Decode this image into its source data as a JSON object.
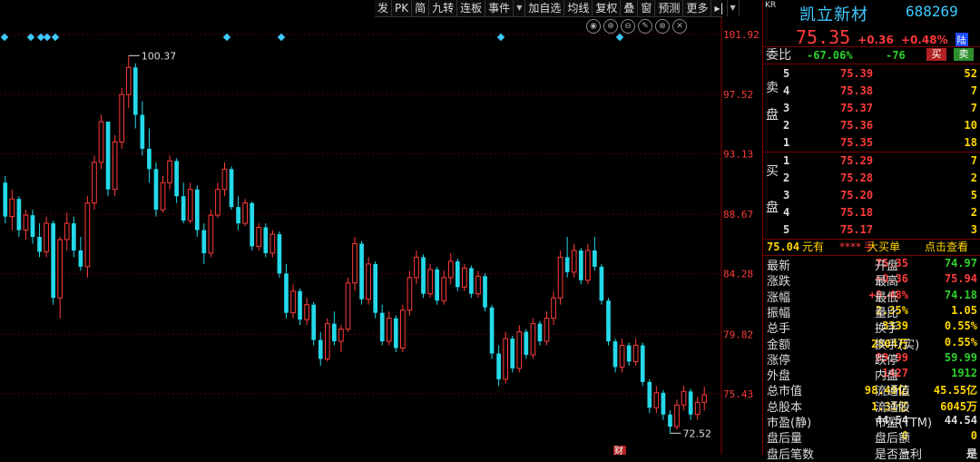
{
  "toolbar": {
    "items": [
      "发",
      "PK",
      "简",
      "九转",
      "连板",
      "事件",
      "加自选",
      "均线",
      "复权",
      "叠",
      "窗",
      "预测",
      "更多"
    ],
    "event_dropdown_arrow": "▼",
    "pin_glyph": "▸|",
    "menu_arrow": "▼"
  },
  "chart_data": {
    "type": "candlestick",
    "y_ticks": [
      "101.92",
      "97.52",
      "93.13",
      "88.67",
      "84.28",
      "79.82",
      "75.43"
    ],
    "annotations": {
      "high": "100.37",
      "low": "72.52"
    },
    "colors": {
      "up": "#ff3b3b",
      "down": "#25d9e9"
    },
    "bottom_marker": "财",
    "candles": [
      [
        91.0,
        91.5,
        88.0,
        88.5
      ],
      [
        88.5,
        90.5,
        87.5,
        89.8
      ],
      [
        89.8,
        90.0,
        87.0,
        87.5
      ],
      [
        87.5,
        89.0,
        86.8,
        88.6
      ],
      [
        88.6,
        89.0,
        86.5,
        87.0
      ],
      [
        87.0,
        88.0,
        85.5,
        85.9
      ],
      [
        85.9,
        88.5,
        85.5,
        88.0
      ],
      [
        88.0,
        88.2,
        82.0,
        82.5
      ],
      [
        82.5,
        87.0,
        81.0,
        86.8
      ],
      [
        86.8,
        88.8,
        86.0,
        88.0
      ],
      [
        88.0,
        88.5,
        85.5,
        86.0
      ],
      [
        86.0,
        87.0,
        84.5,
        84.8
      ],
      [
        84.8,
        90.0,
        84.0,
        89.5
      ],
      [
        89.5,
        93.0,
        89.0,
        92.5
      ],
      [
        92.5,
        96.0,
        92.0,
        95.5
      ],
      [
        95.5,
        94.0,
        90.0,
        90.5
      ],
      [
        90.5,
        94.5,
        90.0,
        94.0
      ],
      [
        94.0,
        98.0,
        93.5,
        97.5
      ],
      [
        97.5,
        100.37,
        96.5,
        99.5
      ],
      [
        99.5,
        99.8,
        95.0,
        96.0
      ],
      [
        96.0,
        97.0,
        93.0,
        93.5
      ],
      [
        93.5,
        95.0,
        91.0,
        92.0
      ],
      [
        92.0,
        92.5,
        88.5,
        89.0
      ],
      [
        89.0,
        91.5,
        88.8,
        91.0
      ],
      [
        91.0,
        93.0,
        90.5,
        92.6
      ],
      [
        92.6,
        92.8,
        89.5,
        90.0
      ],
      [
        90.0,
        91.0,
        88.0,
        88.2
      ],
      [
        88.2,
        91.0,
        88.0,
        90.5
      ],
      [
        90.5,
        90.8,
        87.0,
        87.5
      ],
      [
        87.5,
        88.0,
        85.0,
        85.8
      ],
      [
        85.8,
        89.0,
        85.5,
        88.6
      ],
      [
        88.6,
        91.0,
        88.4,
        90.5
      ],
      [
        90.5,
        92.5,
        90.0,
        92.0
      ],
      [
        92.0,
        92.2,
        89.0,
        89.2
      ],
      [
        89.2,
        90.0,
        87.5,
        88.0
      ],
      [
        88.0,
        89.8,
        87.8,
        89.5
      ],
      [
        89.5,
        89.6,
        86.0,
        86.3
      ],
      [
        86.3,
        88.0,
        86.0,
        87.7
      ],
      [
        87.7,
        88.0,
        85.5,
        85.8
      ],
      [
        85.8,
        87.5,
        85.5,
        87.2
      ],
      [
        87.2,
        87.4,
        84.0,
        84.3
      ],
      [
        84.3,
        85.0,
        81.0,
        81.4
      ],
      [
        81.4,
        83.5,
        81.0,
        83.0
      ],
      [
        83.0,
        83.2,
        80.5,
        80.9
      ],
      [
        80.9,
        82.5,
        80.5,
        82.0
      ],
      [
        82.0,
        82.2,
        79.0,
        79.4
      ],
      [
        79.4,
        80.0,
        77.5,
        78.0
      ],
      [
        78.0,
        81.0,
        77.8,
        80.6
      ],
      [
        80.6,
        81.5,
        79.0,
        79.3
      ],
      [
        79.3,
        80.5,
        78.5,
        80.2
      ],
      [
        80.2,
        84.0,
        80.0,
        83.6
      ],
      [
        83.6,
        87.0,
        83.0,
        86.5
      ],
      [
        86.5,
        86.7,
        82.0,
        82.4
      ],
      [
        82.4,
        85.5,
        82.0,
        85.0
      ],
      [
        85.0,
        85.2,
        81.0,
        81.4
      ],
      [
        81.4,
        82.0,
        79.0,
        79.3
      ],
      [
        79.3,
        81.5,
        79.0,
        81.0
      ],
      [
        81.0,
        81.2,
        78.5,
        78.8
      ],
      [
        78.8,
        82.0,
        78.5,
        81.6
      ],
      [
        81.6,
        84.5,
        81.2,
        84.0
      ],
      [
        84.0,
        86.0,
        83.5,
        85.5
      ],
      [
        85.5,
        85.7,
        82.5,
        82.8
      ],
      [
        82.8,
        85.0,
        82.5,
        84.6
      ],
      [
        84.6,
        84.8,
        82.0,
        82.3
      ],
      [
        82.3,
        84.5,
        82.0,
        84.0
      ],
      [
        84.0,
        85.8,
        83.5,
        85.2
      ],
      [
        85.2,
        85.4,
        83.0,
        83.3
      ],
      [
        83.3,
        85.0,
        83.0,
        84.7
      ],
      [
        84.7,
        84.9,
        82.5,
        82.8
      ],
      [
        82.8,
        84.5,
        82.5,
        84.1
      ],
      [
        84.1,
        84.3,
        81.5,
        81.8
      ],
      [
        81.8,
        82.0,
        78.0,
        78.4
      ],
      [
        78.4,
        79.0,
        76.0,
        76.5
      ],
      [
        76.5,
        80.0,
        76.2,
        79.5
      ],
      [
        79.5,
        79.7,
        77.0,
        77.3
      ],
      [
        77.3,
        80.5,
        77.0,
        80.0
      ],
      [
        80.0,
        80.2,
        78.0,
        78.3
      ],
      [
        78.3,
        81.0,
        78.0,
        80.6
      ],
      [
        80.6,
        80.8,
        79.0,
        79.3
      ],
      [
        79.3,
        81.5,
        79.0,
        81.0
      ],
      [
        81.0,
        83.0,
        80.5,
        82.5
      ],
      [
        82.5,
        86.0,
        82.0,
        85.5
      ],
      [
        85.5,
        87.0,
        84.0,
        84.4
      ],
      [
        84.4,
        86.5,
        84.0,
        86.0
      ],
      [
        86.0,
        86.2,
        83.5,
        83.8
      ],
      [
        83.8,
        86.5,
        83.5,
        86.0
      ],
      [
        86.0,
        87.0,
        84.5,
        84.8
      ],
      [
        84.8,
        85.0,
        82.0,
        82.3
      ],
      [
        82.3,
        82.5,
        79.0,
        79.3
      ],
      [
        79.3,
        79.5,
        77.0,
        77.4
      ],
      [
        77.4,
        79.5,
        77.0,
        79.0
      ],
      [
        79.0,
        79.2,
        77.5,
        77.8
      ],
      [
        77.8,
        79.5,
        77.5,
        79.0
      ],
      [
        79.0,
        79.2,
        76.0,
        76.3
      ],
      [
        76.3,
        76.5,
        74.0,
        74.4
      ],
      [
        74.4,
        76.0,
        74.0,
        75.5
      ],
      [
        75.5,
        75.7,
        73.5,
        73.9
      ],
      [
        73.9,
        74.2,
        72.52,
        73.0
      ],
      [
        73.0,
        75.0,
        72.8,
        74.6
      ],
      [
        74.6,
        76.0,
        74.2,
        75.6
      ],
      [
        75.6,
        75.8,
        73.5,
        73.9
      ],
      [
        73.9,
        75.2,
        73.5,
        74.8
      ],
      [
        74.8,
        75.94,
        74.18,
        75.35
      ]
    ]
  },
  "quote": {
    "kr_badge": "KR",
    "name": "凯立新材",
    "code": "688269",
    "price": "75.35",
    "change": "+0.36",
    "change_pct": "+0.48%",
    "board_tag": "陆",
    "weibi_label": "委比",
    "weibi_pct": "-67.06%",
    "weicha": "-76",
    "buy_btn": "买",
    "sell_btn": "卖",
    "sell_label": [
      "卖",
      "盘"
    ],
    "buy_label": [
      "买",
      "盘"
    ],
    "asks": [
      {
        "lvl": "5",
        "price": "75.39",
        "vol": "52"
      },
      {
        "lvl": "4",
        "price": "75.38",
        "vol": "7"
      },
      {
        "lvl": "3",
        "price": "75.37",
        "vol": "7"
      },
      {
        "lvl": "2",
        "price": "75.36",
        "vol": "10"
      },
      {
        "lvl": "1",
        "price": "75.35",
        "vol": "18"
      }
    ],
    "bids": [
      {
        "lvl": "1",
        "price": "75.29",
        "vol": "7"
      },
      {
        "lvl": "2",
        "price": "75.28",
        "vol": "2"
      },
      {
        "lvl": "3",
        "price": "75.20",
        "vol": "5"
      },
      {
        "lvl": "4",
        "price": "75.18",
        "vol": "2"
      },
      {
        "lvl": "5",
        "price": "75.17",
        "vol": "3"
      }
    ],
    "bigbuy": {
      "price": "75.04",
      "unit": "元有",
      "mask": "****",
      "mask_unit": "手",
      "label": "大买单",
      "action": "点击查看"
    },
    "stats": [
      {
        "l": "最新",
        "v": "75.35",
        "c": "red",
        "l2": "开盘",
        "v2": "74.97",
        "c2": "green"
      },
      {
        "l": "涨跌",
        "v": "+0.36",
        "c": "red",
        "l2": "最高",
        "v2": "75.94",
        "c2": "red"
      },
      {
        "l": "涨幅",
        "v": "+0.48%",
        "c": "red",
        "l2": "最低",
        "v2": "74.18",
        "c2": "green"
      },
      {
        "l": "振幅",
        "v": "2.35%",
        "c": "yellow",
        "l2": "量比",
        "v2": "1.05",
        "c2": "yellow"
      },
      {
        "l": "总手",
        "v": "3339",
        "c": "yellow",
        "l2": "换手",
        "v2": "0.55%",
        "c2": "yellow"
      },
      {
        "l": "金额",
        "v": "2504万",
        "c": "yellow",
        "l2": "换手(实)",
        "v2": "0.55%",
        "c2": "yellow"
      },
      {
        "l": "涨停",
        "v": "89.99",
        "c": "red",
        "l2": "跌停",
        "v2": "59.99",
        "c2": "green"
      },
      {
        "l": "外盘",
        "v": "1427",
        "c": "red",
        "l2": "内盘",
        "v2": "1912",
        "c2": "green"
      },
      {
        "l": "总市值",
        "v": "98.49亿",
        "c": "yellow",
        "l2": "流通值",
        "v2": "45.55亿",
        "c2": "yellow"
      },
      {
        "l": "总股本",
        "v": "1.31亿",
        "c": "yellow",
        "l2": "流通股",
        "v2": "6045万",
        "c2": "yellow"
      },
      {
        "l": "市盈(静)",
        "v": "44.54",
        "c": "white",
        "l2": "市盈(TTM)",
        "v2": "44.54",
        "c2": "white"
      },
      {
        "l": "盘后量",
        "v": "0",
        "c": "yellow",
        "l2": "盘后额",
        "v2": "0",
        "c2": "yellow"
      },
      {
        "l": "盘后笔数",
        "v": "—",
        "c": "white",
        "l2": "是否盈利",
        "v2": "是",
        "c2": "white"
      }
    ]
  },
  "chart_icons": [
    "◉",
    "⊕",
    "⊖",
    "✎",
    "⊗",
    "✕"
  ]
}
